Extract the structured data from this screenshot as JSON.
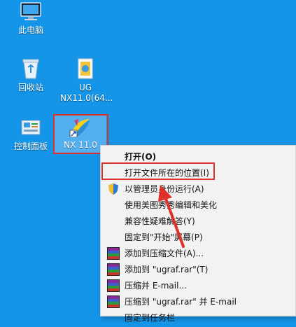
{
  "desktop": {
    "icons": [
      {
        "label": "此电脑"
      },
      {
        "label": "回收站"
      },
      {
        "label_line1": "UG",
        "label_line2": "NX11.0(64..."
      },
      {
        "label": "控制面板"
      },
      {
        "label": "NX 11.0"
      }
    ]
  },
  "context_menu": {
    "items": [
      {
        "label": "打开(O)",
        "bold": true
      },
      {
        "label": "打开文件所在的位置(I)"
      },
      {
        "label": "以管理员身份运行(A)",
        "icon": "shield-icon"
      },
      {
        "label": "使用美图秀秀编辑和美化"
      },
      {
        "label": "兼容性疑难解答(Y)"
      },
      {
        "label": "固定到\"开始\"屏幕(P)"
      },
      {
        "label": "添加到压缩文件(A)...",
        "icon": "winrar-icon"
      },
      {
        "label": "添加到 \"ugraf.rar\"(T)",
        "icon": "winrar-icon"
      },
      {
        "label": "压缩并 E-mail...",
        "icon": "winrar-icon"
      },
      {
        "label": "压缩到 \"ugraf.rar\" 并 E-mail",
        "icon": "winrar-icon"
      },
      {
        "label": "固定到任务栏"
      }
    ]
  },
  "colors": {
    "desktop_bg": "#1495e8",
    "highlight": "#e0302a",
    "menu_bg": "#f2f2f2"
  }
}
